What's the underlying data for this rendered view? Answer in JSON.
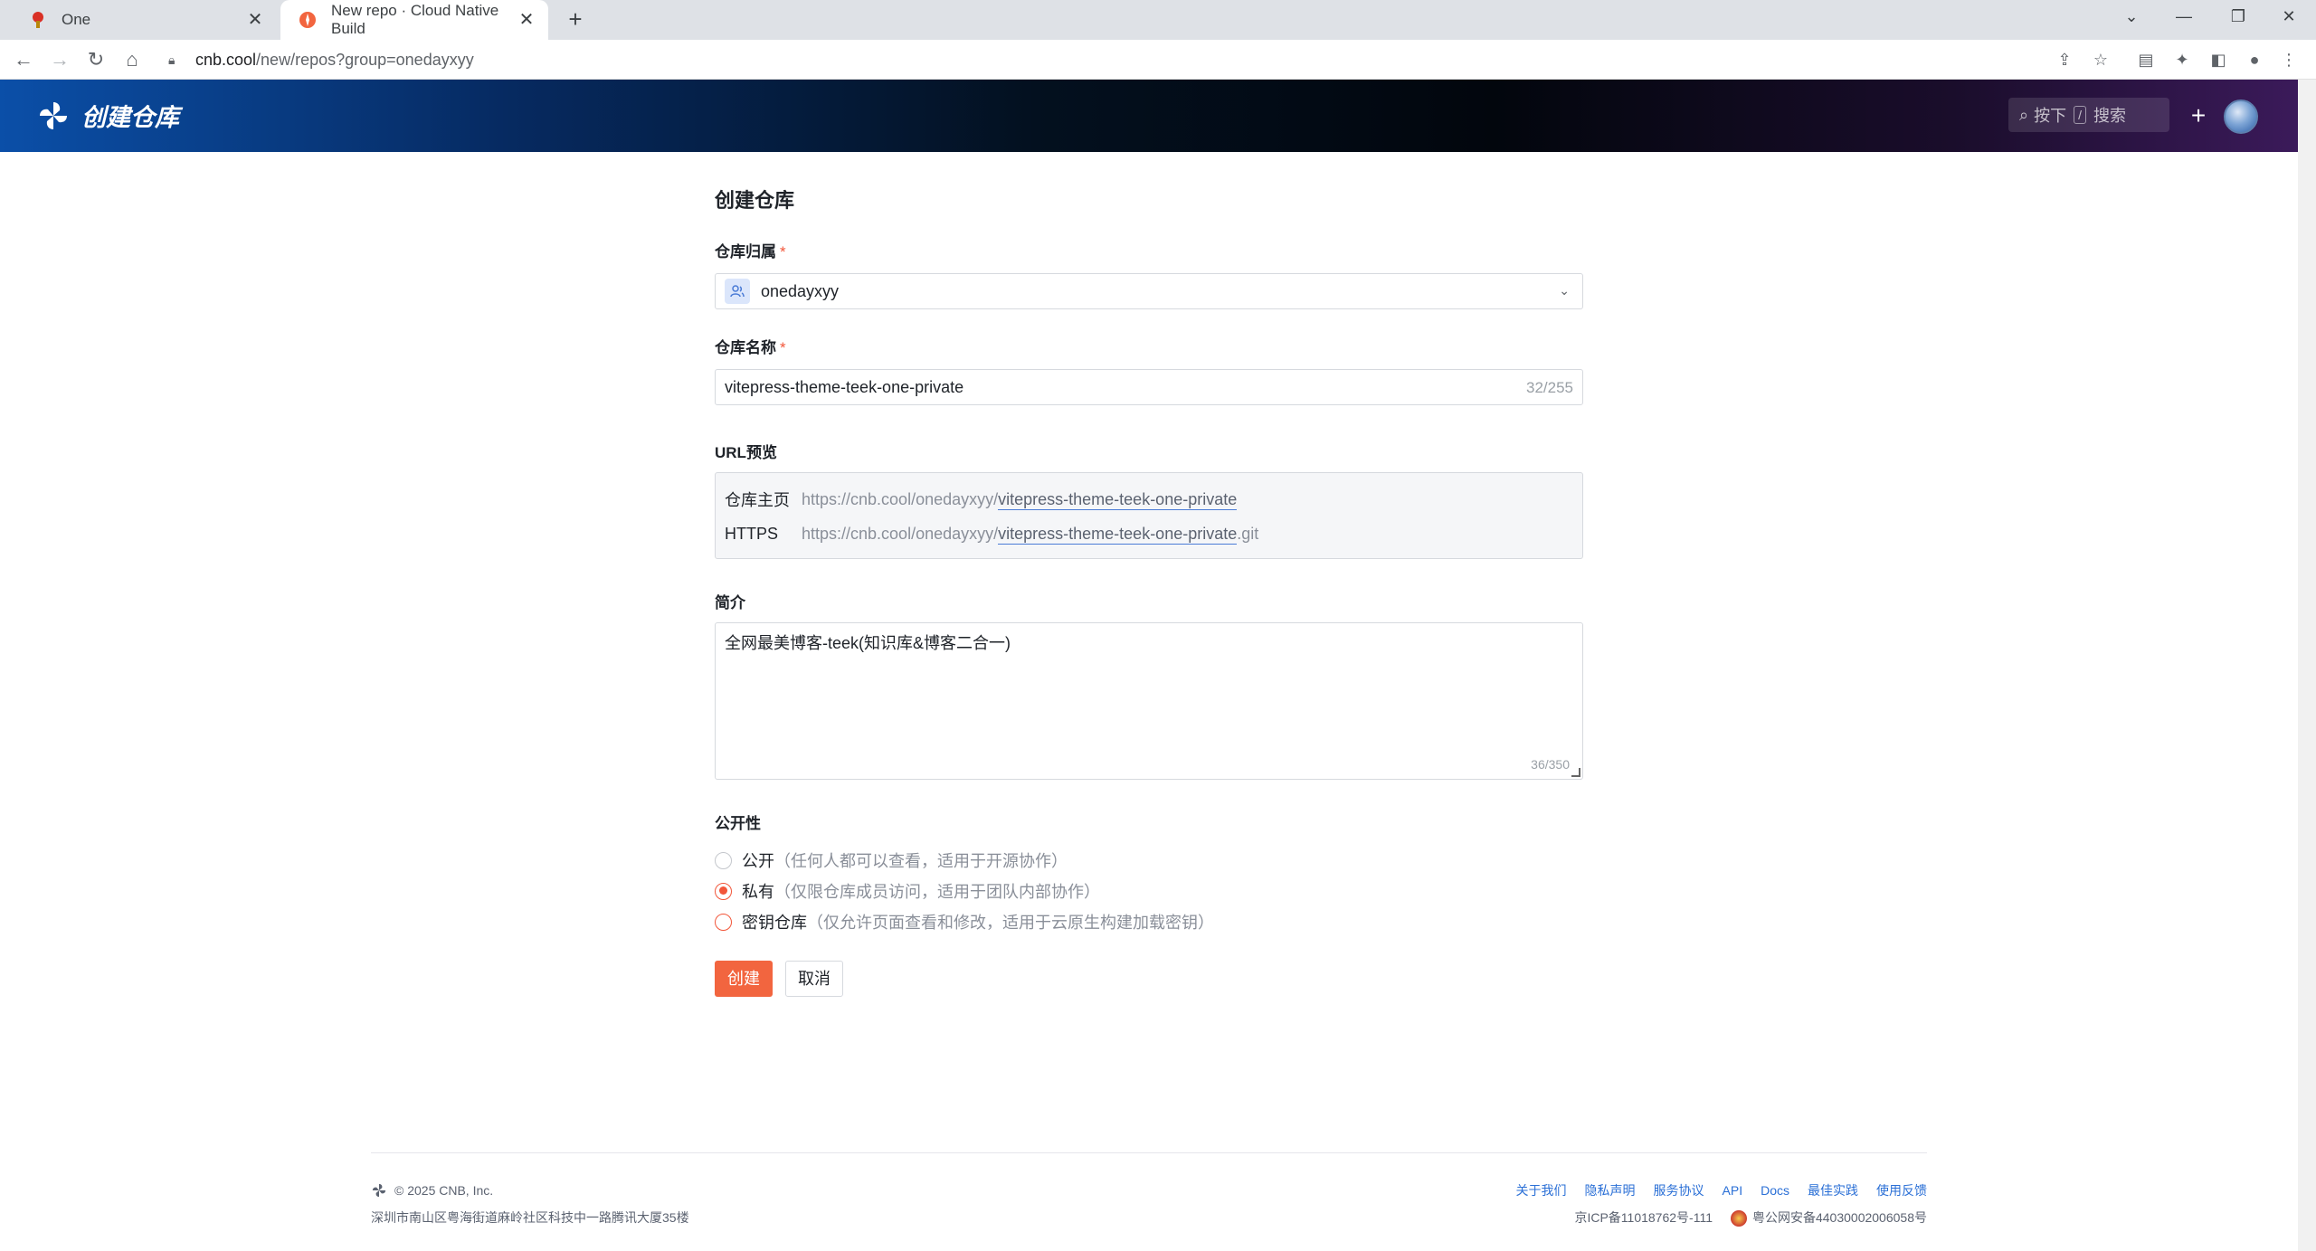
{
  "browser": {
    "tabs": [
      {
        "title": "One",
        "active": false
      },
      {
        "title": "New repo · Cloud Native Build",
        "active": true
      }
    ],
    "url_host": "cnb.cool",
    "url_path": "/new/repos?group=onedayxyy"
  },
  "header": {
    "brand": "创建仓库",
    "search_prefix": "按下",
    "search_key": "/",
    "search_suffix": "搜索"
  },
  "form": {
    "title": "创建仓库",
    "owner_label": "仓库归属",
    "owner_value": "onedayxyy",
    "name_label": "仓库名称",
    "name_value": "vitepress-theme-teek-one-private",
    "name_counter": "32/255",
    "preview_label": "URL预览",
    "preview": {
      "home_key": "仓库主页",
      "https_key": "HTTPS",
      "base": "https://cnb.cool/onedayxyy/",
      "repo": "vitepress-theme-teek-one-private",
      "git_ext": ".git"
    },
    "desc_label": "简介",
    "desc_value": "全网最美博客-teek(知识库&博客二合一)",
    "desc_counter": "36/350",
    "visibility_label": "公开性",
    "visibility_options": [
      {
        "label": "公开",
        "hint": "（任何人都可以查看，适用于开源协作）",
        "checked": false
      },
      {
        "label": "私有",
        "hint": "（仅限仓库成员访问，适用于团队内部协作）",
        "checked": true
      },
      {
        "label": "密钥仓库",
        "hint": "（仅允许页面查看和修改，适用于云原生构建加载密钥）",
        "checked": false
      }
    ],
    "create_label": "创建",
    "cancel_label": "取消"
  },
  "footer": {
    "copyright": "© 2025 CNB, Inc.",
    "address": "深圳市南山区粤海街道麻岭社区科技中一路腾讯大厦35楼",
    "links": [
      "关于我们",
      "隐私声明",
      "服务协议",
      "API",
      "Docs",
      "最佳实践",
      "使用反馈"
    ],
    "icp": "京ICP备11018762号-111",
    "police": "粤公网安备44030002006058号"
  },
  "colors": {
    "accent": "#f2653f",
    "link": "#2a6fd6"
  }
}
